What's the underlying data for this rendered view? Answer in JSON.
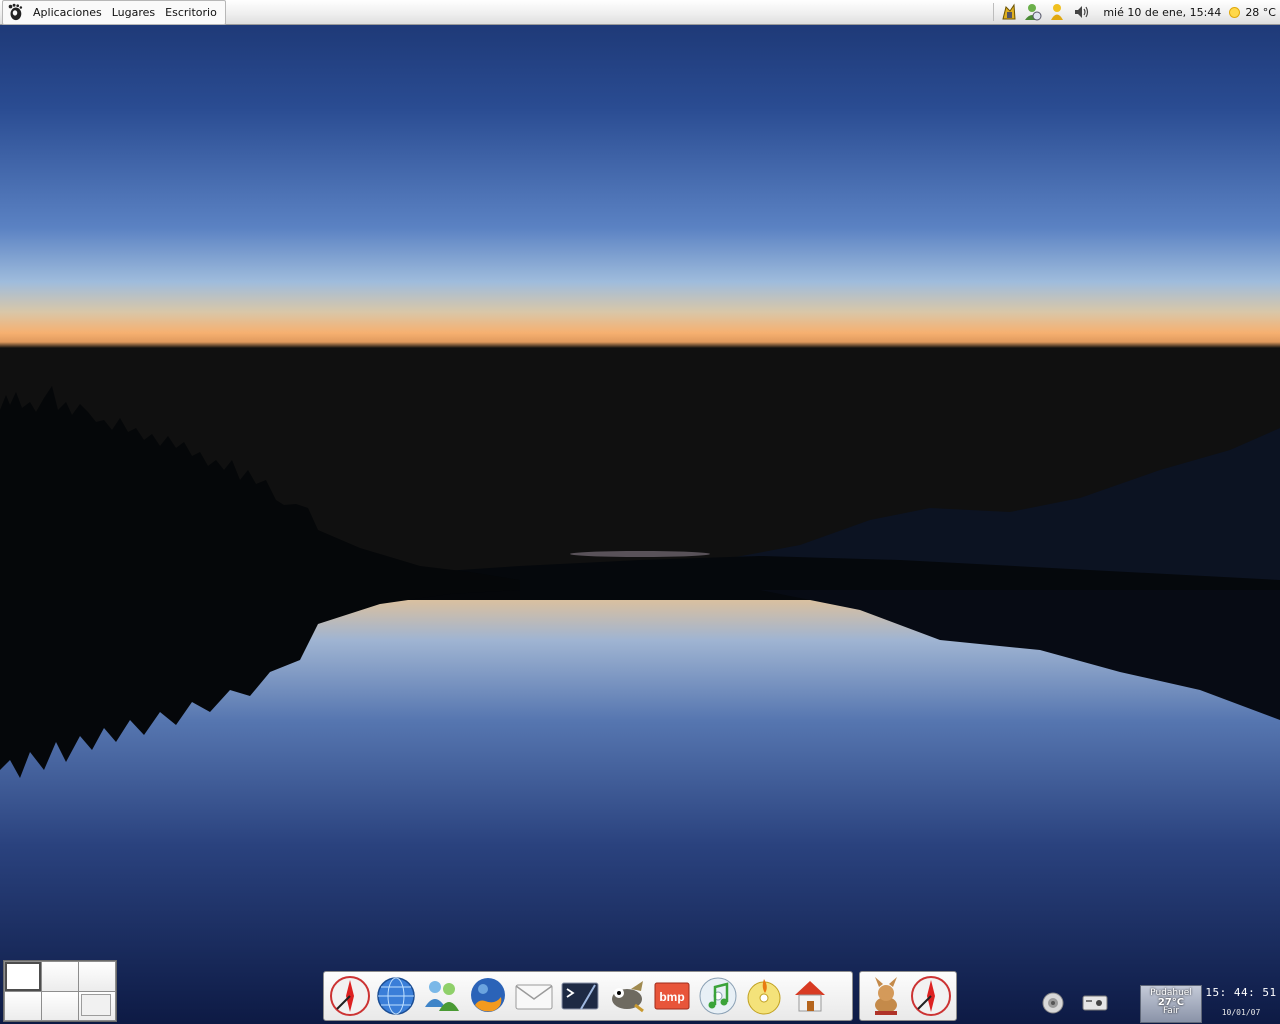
{
  "top_panel": {
    "menus": [
      "Aplicaciones",
      "Lugares",
      "Escritorio"
    ],
    "clock": "mié 10 de ene, 15:44",
    "weather_temp": "28 °C",
    "tray_icons": [
      "notification-icon",
      "messenger-icon",
      "user-icon",
      "volume-icon"
    ]
  },
  "pager": {
    "workspaces": 6,
    "active": 0
  },
  "dock": {
    "launchers": [
      "web-browser-icon",
      "globe-icon",
      "gaim-icon",
      "firefox-icon",
      "mail-icon",
      "terminal-icon",
      "gimp-icon",
      "bmp-icon",
      "music-icon",
      "burner-icon",
      "home-folder-icon"
    ],
    "secondary": [
      "amule-icon",
      "browser-icon"
    ],
    "bmp_label": "bmp"
  },
  "bottom_tray": {
    "weather": {
      "location": "Pudahuel",
      "temp": "27°C",
      "condition": "Fair"
    },
    "time": "15: 44: 51",
    "date": "10/01/07"
  },
  "colors": {
    "sky_top": "#1f3a78",
    "horizon": "#f2b47a",
    "panel": "#eeeeee"
  }
}
